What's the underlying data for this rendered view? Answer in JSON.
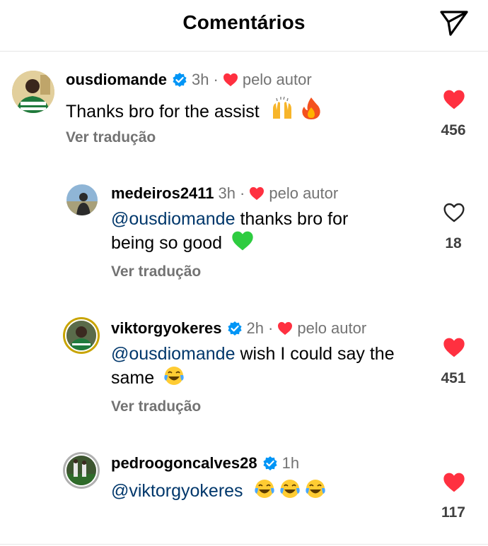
{
  "header": {
    "title": "Comentários"
  },
  "comments": [
    {
      "username": "ousdiomande",
      "verified": true,
      "time": "3h",
      "separator": "·",
      "author_liked": "pelo autor",
      "text": "Thanks bro for the assist",
      "emojis": [
        "raising-hands",
        "fire"
      ],
      "translate": "Ver tradução",
      "likes": "456",
      "liked": true
    },
    {
      "username": "medeiros2411",
      "verified": false,
      "time": "3h",
      "separator": "·",
      "author_liked": "pelo autor",
      "mention": "@ousdiomande",
      "text_line1": " thanks bro for",
      "text_line2": "being so good",
      "emojis": [
        "green-heart"
      ],
      "translate": "Ver tradução",
      "likes": "18",
      "liked": false
    },
    {
      "username": "viktorgyokeres",
      "verified": true,
      "time": "2h",
      "separator": "·",
      "author_liked": "pelo autor",
      "mention": "@ousdiomande",
      "text_line1": " wish I could say the",
      "text_line2": "same",
      "emojis": [
        "laughing-tears"
      ],
      "translate": "Ver tradução",
      "likes": "451",
      "liked": true
    },
    {
      "username": "pedroogoncalves28",
      "verified": true,
      "time": "1h",
      "mention": "@viktorgyokeres",
      "emojis": [
        "laughing-tears",
        "laughing-tears",
        "laughing-tears"
      ],
      "likes": "117",
      "liked": true
    }
  ],
  "colors": {
    "like_red": "#ff3040",
    "verified_blue": "#0095f6",
    "mention_blue": "#00376b",
    "secondary_gray": "#737373"
  }
}
